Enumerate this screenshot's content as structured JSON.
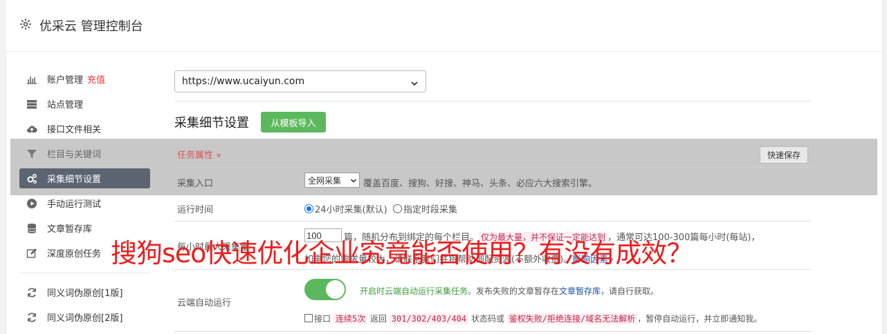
{
  "header": {
    "title": "优采云 管理控制台",
    "icon": "gear-icon"
  },
  "sidebar": {
    "items": [
      {
        "label": "账户管理",
        "extra": "充值",
        "icon": "bar-chart-icon"
      },
      {
        "label": "站点管理",
        "icon": "server-icon"
      },
      {
        "label": "接口文件相关",
        "icon": "cloud-upload-icon"
      },
      {
        "label": "栏目与关键词",
        "icon": "filter-icon"
      },
      {
        "label": "采集细节设置",
        "icon": "cogs-icon",
        "active": true
      },
      {
        "label": "手动运行测试",
        "icon": "play-circle-icon"
      },
      {
        "label": "文章暂存库",
        "icon": "database-icon"
      },
      {
        "label": "深度原创任务",
        "icon": "edit-icon"
      },
      {
        "label": "同义词伪原创[1版]",
        "icon": "refresh-icon"
      },
      {
        "label": "同义词伪原创[2版]",
        "icon": "refresh-icon"
      }
    ]
  },
  "site_select": {
    "value": "https://www.ucaiyun.com"
  },
  "section": {
    "title": "采集细节设置",
    "import_button": "从模板导入"
  },
  "task_bar": {
    "label": "任务属性 »",
    "quick_save": "快速保存"
  },
  "rows": {
    "entry": {
      "label": "采集入口",
      "select_value": "全网采集",
      "desc": "覆盖百度、搜狗、好搜、神马、头条、必应六大搜索引擎。"
    },
    "runtime": {
      "label": "运行时间",
      "opt1": "24小时采集(默认)",
      "opt2": "指定时段采集"
    },
    "hourly": {
      "label": "每小时最大采集量",
      "input_value": "100",
      "line1_a": "篇，随机分布到绑定的每个栏目。",
      "line1_code": "仅为最大量，并不保证一定能达到",
      "line1_b": "，通常可达100-300篇每小时(每站)，",
      "line2": "如需您的需求量较大，请联系我们并将帮助调配资源(不额外收费)。",
      "line2_link": "影响因素»"
    },
    "cloud": {
      "label": "云端自动运行",
      "on_text": "开启时云端自动运行采集任务。",
      "on_text_b": "发布失败的文章暂存在",
      "on_link": "文章暂存库",
      "on_text_c": "，请自行获取。",
      "check_label": "接口",
      "code1": "连续5次",
      "mid1": "返回",
      "code2": "301/302/403/404",
      "mid2": "状态码或",
      "code3": "鉴权失败/拒绝连接/域名无法解析",
      "tail": "，暂停自动运行，并立即通知我。"
    }
  },
  "watermark": "搜狗seo快速优化企业究竟能否使用？有没有成效？",
  "colors": {
    "accent_green": "#5cb85c",
    "active_item": "#5b6470",
    "alert_red": "#ee1c1c"
  }
}
